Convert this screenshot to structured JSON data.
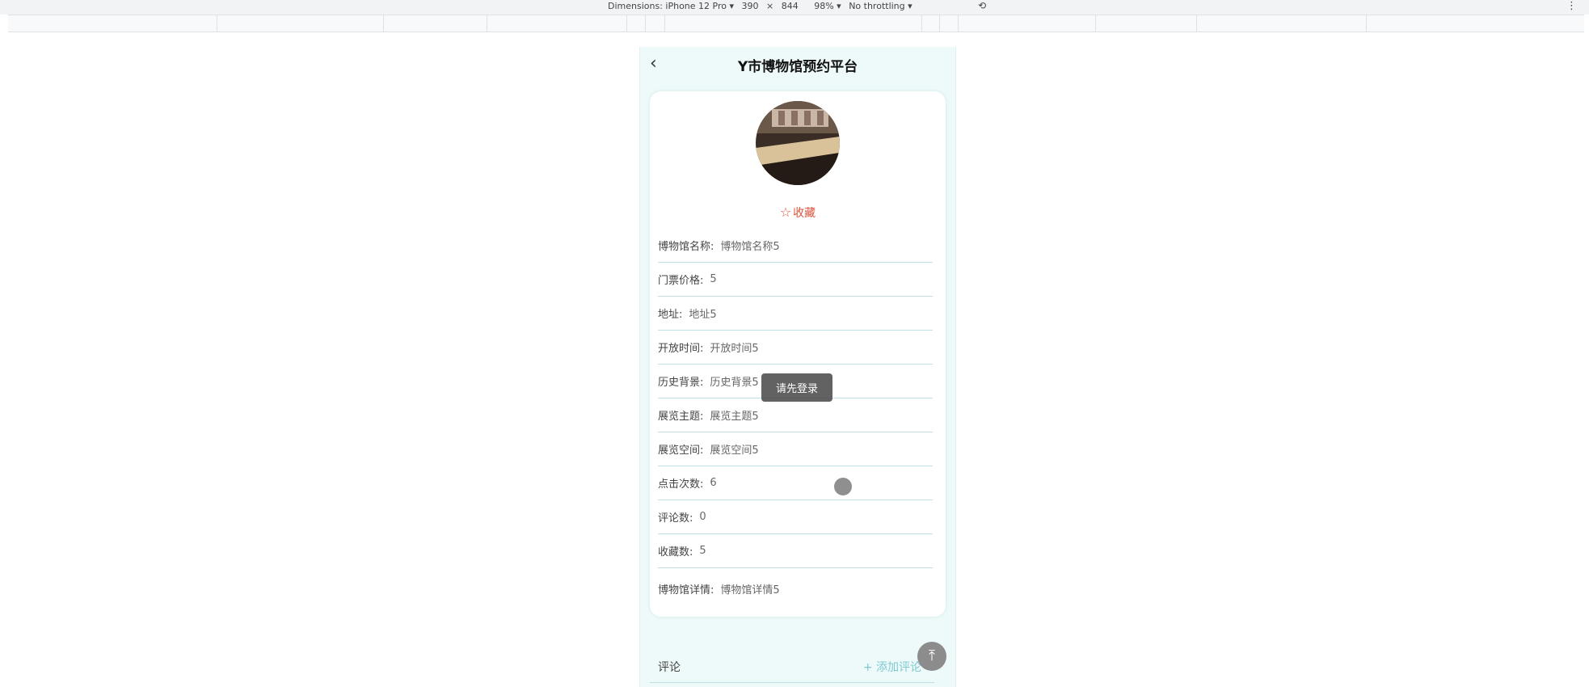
{
  "devtools": {
    "dimensions_label": "Dimensions: iPhone 12 Pro ▾",
    "width": "390",
    "x": "×",
    "height": "844",
    "zoom": "98% ▾",
    "throttling": "No throttling ▾",
    "rotate_icon": "rotate-icon",
    "more_icon": "more-vert-icon"
  },
  "page": {
    "title": "Y市博物馆预约平台",
    "back_icon": "chevron-left-icon"
  },
  "detail": {
    "favorite_label": "收藏",
    "favorite_icon": "star-outline-icon",
    "fields": [
      {
        "label": "博物馆名称:",
        "value": "博物馆名称5"
      },
      {
        "label": "门票价格:",
        "value": "5"
      },
      {
        "label": "地址:",
        "value": "地址5"
      },
      {
        "label": "开放时间:",
        "value": "开放时间5"
      },
      {
        "label": "历史背景:",
        "value": "历史背景5"
      },
      {
        "label": "展览主题:",
        "value": "展览主题5"
      },
      {
        "label": "展览空间:",
        "value": "展览空间5"
      },
      {
        "label": "点击次数:",
        "value": "6"
      },
      {
        "label": "评论数:",
        "value": "0"
      },
      {
        "label": "收藏数:",
        "value": "5"
      },
      {
        "label": "博物馆详情:",
        "value": "博物馆详情5"
      }
    ]
  },
  "toast": "请先登录",
  "comments": {
    "label": "评论",
    "add_label": "+ 添加评论",
    "to_top_icon": "arrow-up-to-top-icon"
  },
  "colors": {
    "accent": "#e0523a",
    "teal": "#7fc9d3",
    "page_bg": "#eefaf9"
  }
}
